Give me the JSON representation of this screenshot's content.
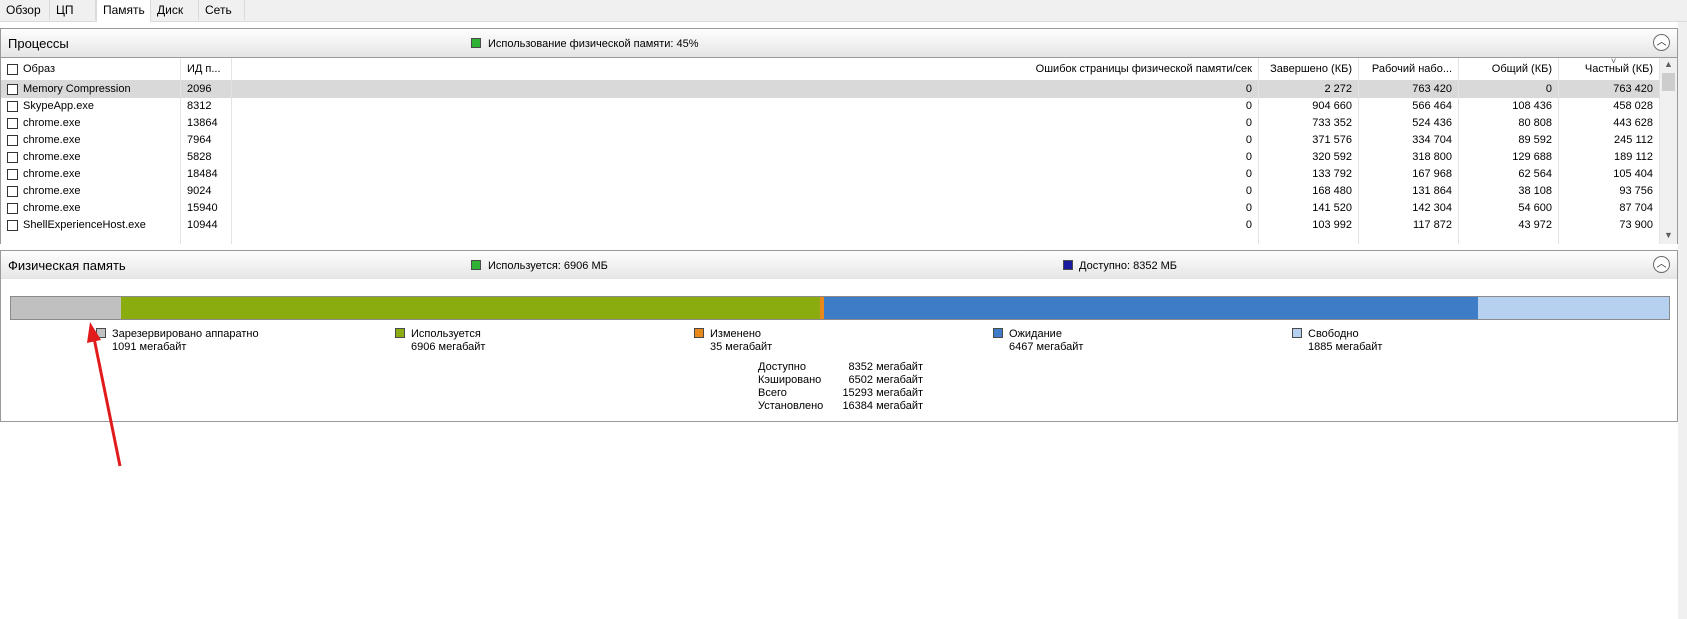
{
  "tabs": [
    "Обзор",
    "ЦП",
    "Память",
    "Диск",
    "Сеть"
  ],
  "active_tab": "Память",
  "processes": {
    "title": "Процессы",
    "usage_label": "Использование физической памяти: 45%",
    "usage_color": "#2fb233",
    "columns": [
      "Образ",
      "ИД п...",
      "Ошибок страницы физической памяти/сек",
      "Завершено (КБ)",
      "Рабочий набо...",
      "Общий (КБ)",
      "Частный (КБ)"
    ],
    "rows": [
      {
        "name": "Memory Compression",
        "pid": "2096",
        "faults": "0",
        "commit": "2 272",
        "working": "763 420",
        "shared": "0",
        "private": "763 420"
      },
      {
        "name": "SkypeApp.exe",
        "pid": "8312",
        "faults": "0",
        "commit": "904 660",
        "working": "566 464",
        "shared": "108 436",
        "private": "458 028"
      },
      {
        "name": "chrome.exe",
        "pid": "13864",
        "faults": "0",
        "commit": "733 352",
        "working": "524 436",
        "shared": "80 808",
        "private": "443 628"
      },
      {
        "name": "chrome.exe",
        "pid": "7964",
        "faults": "0",
        "commit": "371 576",
        "working": "334 704",
        "shared": "89 592",
        "private": "245 112"
      },
      {
        "name": "chrome.exe",
        "pid": "5828",
        "faults": "0",
        "commit": "320 592",
        "working": "318 800",
        "shared": "129 688",
        "private": "189 112"
      },
      {
        "name": "chrome.exe",
        "pid": "18484",
        "faults": "0",
        "commit": "133 792",
        "working": "167 968",
        "shared": "62 564",
        "private": "105 404"
      },
      {
        "name": "chrome.exe",
        "pid": "9024",
        "faults": "0",
        "commit": "168 480",
        "working": "131 864",
        "shared": "38 108",
        "private": "93 756"
      },
      {
        "name": "chrome.exe",
        "pid": "15940",
        "faults": "0",
        "commit": "141 520",
        "working": "142 304",
        "shared": "54 600",
        "private": "87 704"
      },
      {
        "name": "ShellExperienceHost.exe",
        "pid": "10944",
        "faults": "0",
        "commit": "103 992",
        "working": "117 872",
        "shared": "43 972",
        "private": "73 900"
      }
    ]
  },
  "memory": {
    "title": "Физическая память",
    "used_label": "Используется: 6906 МБ",
    "used_color": "#2fb233",
    "available_label": "Доступно: 8352 МБ",
    "available_color": "#1a1aa0",
    "bar": {
      "reserved_mb": 1091,
      "in_use_mb": 6906,
      "modified_mb": 35,
      "standby_mb": 6467,
      "free_mb": 1885
    },
    "colors": {
      "reserved": "#c0c0c0",
      "in_use": "#8aac0e",
      "modified": "#e8891a",
      "standby": "#3f7cc8",
      "free": "#b6d1ef"
    },
    "legend": [
      {
        "name": "Зарезервировано аппаратно",
        "value": "1091 мегабайт"
      },
      {
        "name": "Используется",
        "value": "6906 мегабайт"
      },
      {
        "name": "Изменено",
        "value": "35 мегабайт"
      },
      {
        "name": "Ожидание",
        "value": "6467 мегабайт"
      },
      {
        "name": "Свободно",
        "value": "1885 мегабайт"
      }
    ],
    "stats": [
      {
        "label": "Доступно",
        "value": "8352 мегабайт"
      },
      {
        "label": "Кэшировано",
        "value": "6502 мегабайт"
      },
      {
        "label": "Всего",
        "value": "15293 мегабайт"
      },
      {
        "label": "Установлено",
        "value": "16384 мегабайт"
      }
    ]
  },
  "icons": [
    "chevron-up-icon",
    "checkbox-icon",
    "scroll-up-icon",
    "scroll-down-icon",
    "red-arrow-annotation"
  ]
}
